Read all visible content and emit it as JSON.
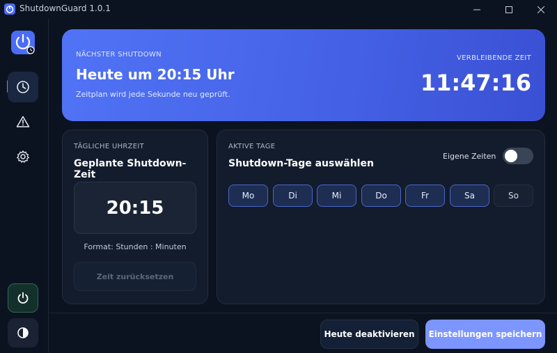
{
  "window": {
    "title": "ShutdownGuard 1.0.1"
  },
  "icons": {
    "app": "power-clock-icon",
    "minimize": "minimize-icon",
    "maximize": "maximize-icon",
    "close": "close-icon",
    "nav_schedule": "clock-icon",
    "nav_warning": "warning-icon",
    "nav_settings": "gear-icon",
    "power": "power-icon",
    "theme": "contrast-icon"
  },
  "colors": {
    "accent": "#4a6cf7",
    "hero_start": "#5173f5",
    "hero_end": "#3a50d4",
    "power_green": "#2f6a55",
    "save_button": "#7c95ff"
  },
  "hero": {
    "eyebrow": "NÄCHSTER SHUTDOWN",
    "title": "Heute um 20:15 Uhr",
    "subtitle": "Zeitplan wird jede Sekunde neu geprüft.",
    "remaining_label": "VERBLEIBENDE ZEIT",
    "remaining_value": "11:47:16"
  },
  "daily_time": {
    "eyebrow": "TÄGLICHE UHRZEIT",
    "title": "Geplante Shutdown-Zeit",
    "time": "20:15",
    "format_hint": "Format: Stunden : Minuten",
    "reset_label": "Zeit zurücksetzen"
  },
  "active_days": {
    "eyebrow": "AKTIVE TAGE",
    "title": "Shutdown-Tage auswählen",
    "toggle_label": "Eigene Zeiten",
    "toggle_on": false,
    "days": [
      {
        "label": "Mo",
        "active": true
      },
      {
        "label": "Di",
        "active": true
      },
      {
        "label": "Mi",
        "active": true
      },
      {
        "label": "Do",
        "active": true
      },
      {
        "label": "Fr",
        "active": true
      },
      {
        "label": "Sa",
        "active": true
      },
      {
        "label": "So",
        "active": false
      }
    ]
  },
  "footer": {
    "deactivate_label": "Heute deaktivieren",
    "save_label": "Einstellungen speichern"
  }
}
